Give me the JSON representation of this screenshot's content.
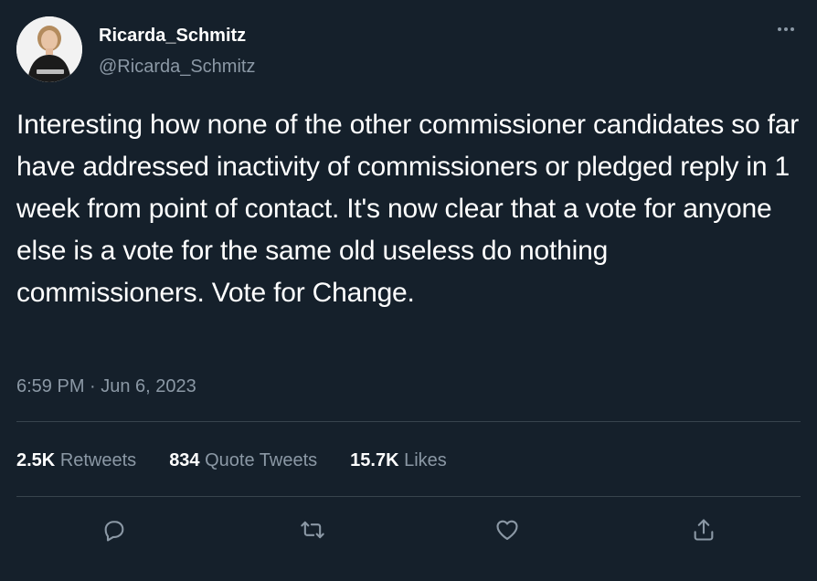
{
  "author": {
    "display_name": "Ricarda_Schmitz",
    "handle": "@Ricarda_Schmitz"
  },
  "tweet": {
    "text": "Interesting how none of the other commissioner candidates so far have addressed inactivity of commissioners or pledged reply in 1 week from point of contact. It's now clear that a vote for anyone else is a vote for the same old useless do nothing commissioners. Vote for Change.",
    "timestamp": "6:59 PM · Jun 6, 2023"
  },
  "stats": {
    "retweets": {
      "count": "2.5K",
      "label": "Retweets"
    },
    "quotes": {
      "count": "834",
      "label": "Quote Tweets"
    },
    "likes": {
      "count": "15.7K",
      "label": "Likes"
    }
  },
  "icons": {
    "more": "more-horizontal-icon",
    "reply": "reply-icon",
    "retweet": "retweet-icon",
    "like": "heart-icon",
    "share": "share-icon"
  },
  "colors": {
    "background": "#15202b",
    "secondary_text": "#8b98a5",
    "divider": "#38444d"
  }
}
